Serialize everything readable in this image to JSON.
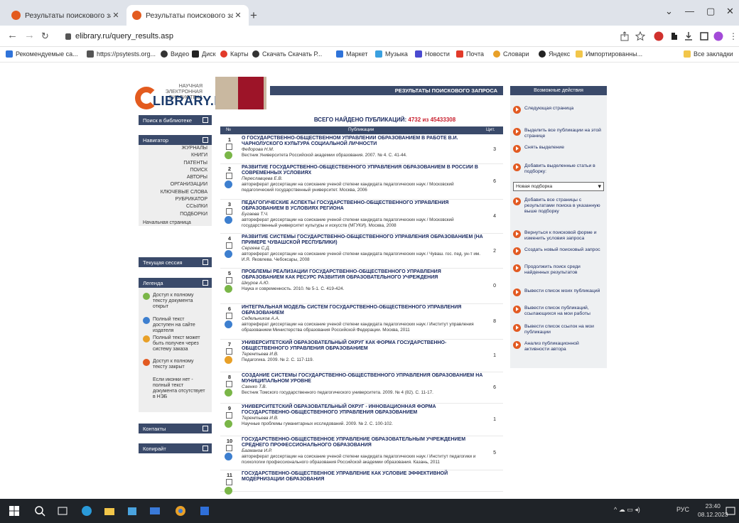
{
  "tabs": [
    {
      "title": "Результаты поискового запро"
    },
    {
      "title": "Результаты поискового запро"
    }
  ],
  "address": {
    "url": "elibrary.ru/query_results.asp"
  },
  "bookmarks": [
    "Рекомендуемые са...",
    "https://psytests.org...",
    "Видео",
    "Диск",
    "Карты",
    "Скачать Скачать Р...",
    "Маркет",
    "Музыка",
    "Новости",
    "Почта",
    "Словари",
    "Яндекс",
    "Импортированны..."
  ],
  "bookmarks_all": "Все закладки",
  "logo": {
    "line1": "НАУЧНАЯ ЭЛЕКТРОННАЯ",
    "line2": "БИБЛИОТЕКА",
    "name": "LIBRARY.RU"
  },
  "sidebar": {
    "search_header": "Поиск в библиотеке",
    "navigator_header": "Навигатор",
    "nav_items": [
      "ЖУРНАЛЫ",
      "КНИГИ",
      "ПАТЕНТЫ",
      "ПОИСК",
      "АВТОРЫ",
      "ОРГАНИЗАЦИИ",
      "КЛЮЧЕВЫЕ СЛОВА",
      "РУБРИКАТОР",
      "ССЫЛКИ",
      "ПОДБОРКИ"
    ],
    "home": "Начальная страница",
    "session_header": "Текущая сессия",
    "legend_header": "Легенда",
    "legend": [
      {
        "text": "Доступ к полному тексту документа открыт",
        "color": "#7ab648"
      },
      {
        "text": "Полный текст доступен на сайте издателя",
        "color": "#3d7fcf"
      },
      {
        "text": "Полный текст может быть получен через систему заказа",
        "color": "#e8a028"
      },
      {
        "text": "Доступ к полному тексту закрыт",
        "color": "#e25a22"
      }
    ],
    "legend_note": "Если иконки нет - полный текст документа отсутствует в НЭБ",
    "contacts_header": "Контакты",
    "copyright_header": "Копирайт"
  },
  "main": {
    "header": "РЕЗУЛЬТАТЫ ПОИСКОВОГО ЗАПРОСА",
    "total_label": "ВСЕГО НАЙДЕНО ПУБЛИКАЦИЙ:",
    "total_found": "4732",
    "total_of": "из",
    "total_all": "45433308",
    "col_num": "№",
    "col_pub": "Публикации",
    "col_cit": "Цит.",
    "rows": [
      {
        "num": "1",
        "title": "О ГОСУДАРСТВЕННО-ОБЩЕСТВЕННОМ УПРАВЛЕНИИ ОБРАЗОВАНИЕМ В РАБОТЕ В.И. ЧАРНОЛУСКОГО КУЛЬТУРА СОЦИАЛЬНОЙ ЛИЧНОСТИ",
        "author": "Федорова Н.М.",
        "source": "Вестник Университета Российской академии образования. 2007. № 4. С. 41-44.",
        "cit": "3",
        "access": "#7ab648"
      },
      {
        "num": "2",
        "title": "РАЗВИТИЕ ГОСУДАРСТВЕННО-ОБЩЕСТВЕННОГО УПРАВЛЕНИЯ ОБРАЗОВАНИЕМ В РОССИИ В СОВРЕМЕННЫХ УСЛОВИЯХ",
        "author": "Переславцева Е.В.",
        "source": "автореферат диссертации на соискание ученой степени кандидата педагогических наук / Московский педагогический государственный университет. Москва, 2006",
        "cit": "6",
        "access": "#3d7fcf"
      },
      {
        "num": "3",
        "title": "ПЕДАГОГИЧЕСКИЕ АСПЕКТЫ ГОСУДАРСТВЕННО-ОБЩЕСТВЕННОГО УПРАВЛЕНИЯ ОБРАЗОВАНИЕМ В УСЛОВИЯХ РЕГИОНА",
        "author": "Бугаева Т.Ч.",
        "source": "автореферат диссертации на соискание ученой степени кандидата педагогических наук / Московский государственный университет культуры и искусств (МГУКИ). Москва, 2008",
        "cit": "4",
        "access": "#3d7fcf"
      },
      {
        "num": "4",
        "title": "РАЗВИТИЕ СИСТЕМЫ ГОСУДАРСТВЕННО-ОБЩЕСТВЕННОГО УПРАВЛЕНИЯ ОБРАЗОВАНИЕМ (НА ПРИМЕРЕ ЧУВАШСКОЙ РЕСПУБЛИКИ)",
        "author": "Сергеев С.Д.",
        "source": "автореферат диссертации на соискание ученой степени кандидата педагогических наук / Чуваш. гос. пед. ун-т им. И.Я. Яковлева. Чебоксары, 2008",
        "cit": "2",
        "access": "#3d7fcf"
      },
      {
        "num": "5",
        "title": "ПРОБЛЕМЫ РЕАЛИЗАЦИИ ГОСУДАРСТВЕННО-ОБЩЕСТВЕННОГО УПРАВЛЕНИЯ ОБРАЗОВАНИЕМ КАК РЕСУРС РАЗВИТИЯ ОБРАЗОВАТЕЛЬНОГО УЧРЕЖДЕНИЯ",
        "author": "Шкуров А.Ю.",
        "source": "Наука и современность. 2010. № 5-1. С. 419-424.",
        "cit": "0",
        "access": "#7ab648"
      },
      {
        "num": "6",
        "title": "ИНТЕГРАЛЬНАЯ МОДЕЛЬ СИСТЕМ ГОСУДАРСТВЕННО-ОБЩЕСТВЕННОГО УПРАВЛЕНИЯ ОБРАЗОВАНИЕМ",
        "author": "Седельников А.А.",
        "source": "автореферат диссертации на соискание ученой степени кандидата педагогических наук / Институт управления образованием Министерства образования Российской Федерации. Москва, 2011",
        "cit": "8",
        "access": "#3d7fcf"
      },
      {
        "num": "7",
        "title": "УНИВЕРСИТЕТСКИЙ ОБРАЗОВАТЕЛЬНЫЙ ОКРУГ КАК ФОРМА ГОСУДАРСТВЕННО-ОБЩЕСТВЕННОГО УПРАВЛЕНИЯ ОБРАЗОВАНИЕМ",
        "author": "Терентьева И.В.",
        "source": "Педагогика. 2009. № 2. С. 117-119.",
        "cit": "1",
        "access": "#e8a028"
      },
      {
        "num": "8",
        "title": "СОЗДАНИЕ СИСТЕМЫ ГОСУДАРСТВЕННО-ОБЩЕСТВЕННОГО УПРАВЛЕНИЯ ОБРАЗОВАНИЕМ НА МУНИЦИПАЛЬНОМ УРОВНЕ",
        "author": "Саенко Т.В.",
        "source": "Вестник Томского государственного педагогического университета. 2009. № 4 (82). С. 11-17.",
        "cit": "6",
        "access": "#7ab648"
      },
      {
        "num": "9",
        "title": "УНИВЕРСИТЕТСКИЙ ОБРАЗОВАТЕЛЬНЫЙ ОКРУГ - ИННОВАЦИОННАЯ ФОРМА ГОСУДАРСТВЕННО-ОБЩЕСТВЕННОГО УПРАВЛЕНИЯ ОБРАЗОВАНИЕМ",
        "author": "Терентьева И.В.",
        "source": "Научные проблемы гуманитарных исследований. 2009. № 2. С. 100-102.",
        "cit": "1",
        "access": "#7ab648"
      },
      {
        "num": "10",
        "title": "ГОСУДАРСТВЕННО-ОБЩЕСТВЕННОЕ УПРАВЛЕНИЕ ОБРАЗОВАТЕЛЬНЫМ УЧРЕЖДЕНИЕМ СРЕДНЕГО ПРОФЕССИОНАЛЬНОГО ОБРАЗОВАНИЯ",
        "author": "Багманов И.Р.",
        "source": "автореферат диссертации на соискание ученой степени кандидата педагогических наук / Институт педагогики и психологии профессионального образования Российской академии образования. Казань, 2011",
        "cit": "5",
        "access": "#3d7fcf"
      },
      {
        "num": "11",
        "title": "ГОСУДАРСТВЕННО-ОБЩЕСТВЕННОЕ УПРАВЛЕНИЕ КАК УСЛОВИЕ ЭФФЕКТИВНОЙ МОДЕРНИЗАЦИИ ОБРАЗОВАНИЯ",
        "author": "",
        "source": "",
        "cit": "",
        "access": "#7ab648"
      }
    ]
  },
  "actions": {
    "header": "Возможные действия",
    "next": "Следующая страница",
    "select_all": "Выделить все публикации на этой странице",
    "clear": "Снять выделение",
    "add_selected": "Добавить выделенные статьи в подборку:",
    "select_value": "Новая подборка",
    "add_all": "Добавить все страницы с результатами поиска в указанную выше подборку",
    "back": "Вернуться к поисковой форме и изменить условия запроса",
    "new_query": "Создать новый поисковый запрос",
    "continue": "Продолжить поиск среди найденных результатов",
    "my_pubs": "Вывести список моих публикаций",
    "citing": "Вывести список публикаций, ссылающихся на мои работы",
    "refs": "Вывести список ссылок на мои публикации",
    "analysis": "Анализ публикационной активности автора"
  },
  "taskbar": {
    "lang": "РУС",
    "time": "23:40",
    "date": "08.12.2023"
  }
}
